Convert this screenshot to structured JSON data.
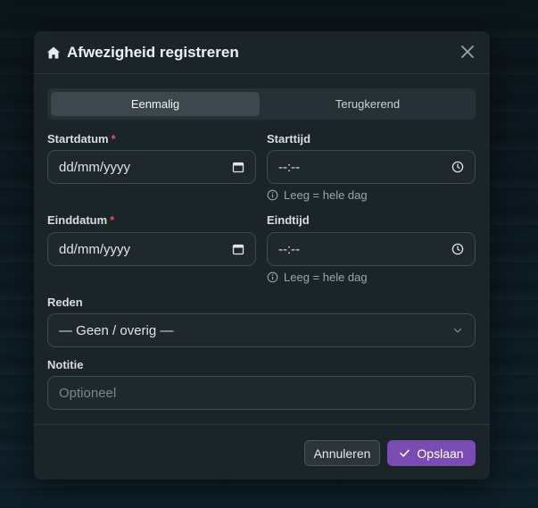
{
  "dialog": {
    "title": "Afwezigheid registreren"
  },
  "tabs": [
    {
      "label": "Eenmalig",
      "active": true
    },
    {
      "label": "Terugkerend",
      "active": false
    }
  ],
  "form": {
    "start_date": {
      "label": "Startdatum",
      "required_mark": "*",
      "value": "dd/mm/yyyy"
    },
    "start_time": {
      "label": "Starttijd",
      "value": "--:--",
      "hint": "Leeg = hele dag"
    },
    "end_date": {
      "label": "Einddatum",
      "required_mark": "*",
      "value": "dd/mm/yyyy"
    },
    "end_time": {
      "label": "Eindtijd",
      "value": "--:--",
      "hint": "Leeg = hele dag"
    },
    "reason": {
      "label": "Reden",
      "value": "— Geen / overig —"
    },
    "note": {
      "label": "Notitie",
      "placeholder": "Optioneel"
    }
  },
  "footer": {
    "cancel_label": "Annuleren",
    "save_label": "Opslaan"
  },
  "colors": {
    "accent": "#7a4bb3",
    "required": "#e0535a",
    "dialog_bg": "#1b2429"
  },
  "icons": [
    "home-icon",
    "close-icon",
    "calendar-icon",
    "clock-icon",
    "info-icon",
    "chevron-down-icon",
    "check-icon"
  ]
}
